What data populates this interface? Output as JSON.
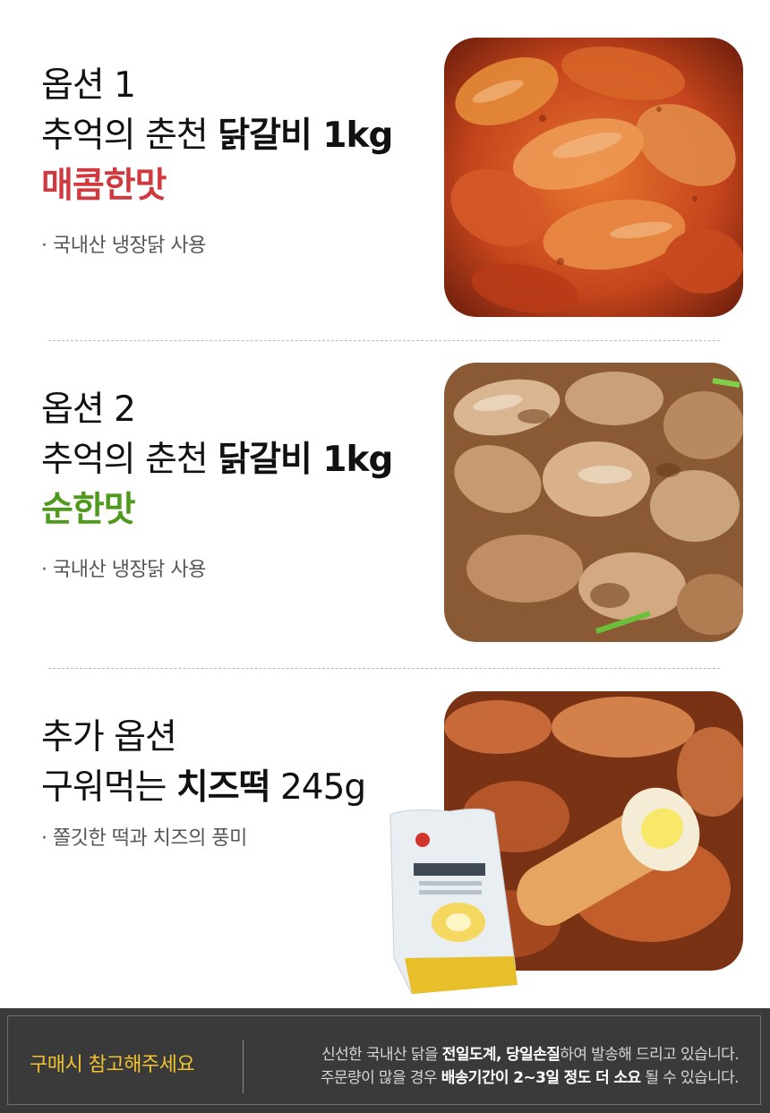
{
  "colors": {
    "spicy": "#d0393d",
    "mild": "#4f9a1c",
    "footer_bg": "#3a3a3a",
    "footer_title": "#f2c230"
  },
  "option1": {
    "label": "옵션 1",
    "prefix": "추억의 춘천 ",
    "product": "닭갈비 1kg",
    "flavor": "매콤한맛",
    "note": "· 국내산 냉장닭 사용",
    "photo": "spicy-dakgalbi-photo"
  },
  "option2": {
    "label": "옵션 2",
    "prefix": "추억의 춘천 ",
    "product": "닭갈비 1kg",
    "flavor": "순한맛",
    "note": "· 국내산 냉장닭 사용",
    "photo": "mild-dakgalbi-photo"
  },
  "extra": {
    "label": "추가 옵션",
    "prefix": "구워먹는 ",
    "product": "치즈떡",
    "weight": " 245g",
    "note": "· 쫄깃한 떡과 치즈의 풍미",
    "photo": "cheese-tteok-photo",
    "package_icon": "cheese-tteok-package"
  },
  "footer": {
    "title": "구매시 참고해주세요",
    "line1_a": "신선한 국내산 닭을 ",
    "line1_b": "전일도계, 당일손질",
    "line1_c": "하여 발송해 드리고 있습니다.",
    "line2_a": "주문량이 많을 경우 ",
    "line2_b": "배송기간이 2~3일 정도 더 소요",
    "line2_c": " 될 수 있습니다."
  }
}
